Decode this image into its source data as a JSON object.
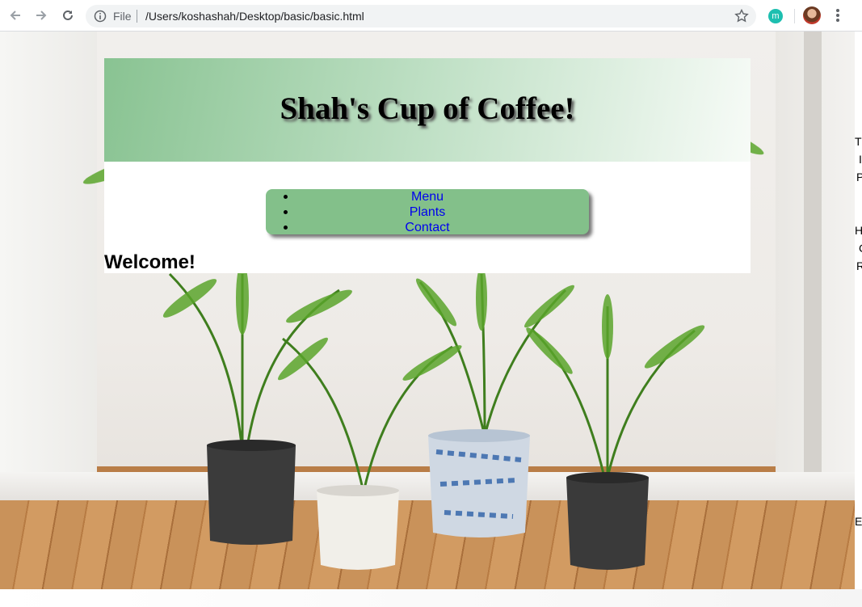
{
  "browser": {
    "scheme_label": "File",
    "url": "/Users/koshashah/Desktop/basic/basic.html",
    "extension_letter": "m"
  },
  "site": {
    "title": "Shah's Cup of Coffee!",
    "nav": [
      "Menu",
      "Plants",
      "Contact"
    ],
    "welcome": "Welcome!"
  },
  "cutoff_text": [
    "T",
    "I",
    "P",
    "H",
    "C",
    "R",
    "E"
  ],
  "colors": {
    "banner_start": "#89c392",
    "nav_bg": "#83c08a",
    "link": "#0000ee",
    "extension": "#1dbfb0"
  }
}
